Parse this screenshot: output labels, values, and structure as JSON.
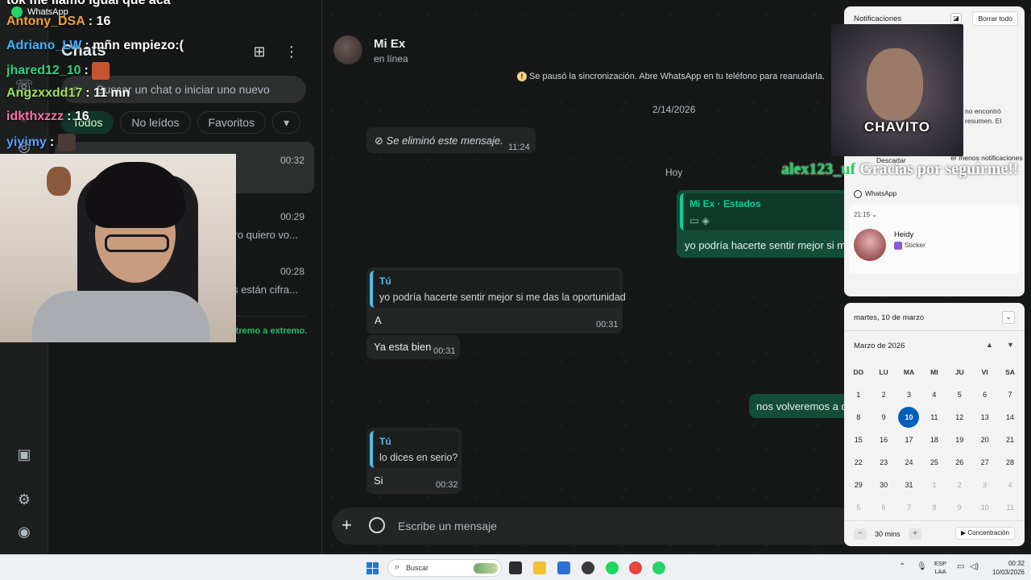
{
  "whatsapp": {
    "chat_list": {
      "title": "Chats",
      "search_placeholder": "Buscar un chat o iniciar uno nuevo",
      "filters": [
        "Todos",
        "No leídos",
        "Favoritos"
      ],
      "items": [
        {
          "time": "00:32",
          "preview": ""
        },
        {
          "time": "00:29",
          "preview": "ero quiero vo..."
        },
        {
          "time": "00:28",
          "preview": "s están cifra..."
        }
      ],
      "encryption_note": "os de extremo a extremo."
    },
    "conversation": {
      "contact_name": "Mi Ex",
      "contact_status": "en línea",
      "sync_notice": "Se pausó la sincronización. Abre WhatsApp en tu teléfono para reanudarla.",
      "date_1": "2/14/2026",
      "date_2": "Hoy",
      "messages": [
        {
          "text": "Se eliminó este mensaje.",
          "time": "11:24"
        },
        {
          "quote_name": "Mi Ex · Estados",
          "text": "yo podría hacerte sentir mejor si m"
        },
        {
          "quote_name": "Tú",
          "quote_text": "yo podría hacerte sentir mejor si me das la oportunidad",
          "text": "A",
          "time": "00:31"
        },
        {
          "text": "Ya esta bien",
          "time": "00:31"
        },
        {
          "text": "nos volveremos a d"
        },
        {
          "quote_name": "Tú",
          "quote_text": "lo dices en serio?",
          "text": "Si",
          "time": "00:32"
        }
      ],
      "composer_placeholder": "Escribe un mensaje"
    }
  },
  "stream_overlay": {
    "chat_lines": [
      {
        "user": "tok me llamo igual que aca",
        "color": "#ffffff",
        "text": ""
      },
      {
        "user": "Antony_DSA",
        "color": "#f0a238",
        "text": ": 16"
      },
      {
        "user": "Adriano_LW",
        "color": "#3fb4ff",
        "text": ": mñn empiezo:("
      },
      {
        "user": "jhared12_10",
        "color": "#35d07f",
        "text": ":"
      },
      {
        "user": "Angzxxdd17",
        "color": "#9be15d",
        "text": ": 11 mn"
      },
      {
        "user": "idkthxzzz",
        "color": "#ff6fa8",
        "text": ": 16"
      },
      {
        "user": "yiyimy",
        "color": "#5aa0ff",
        "text": ":"
      }
    ],
    "wa_tag": "WhatsApp",
    "alert_name": "CHAVITO",
    "alert_user": "alex123_uf",
    "alert_message": "Gracias por seguirme!!"
  },
  "notifications": {
    "title": "Notificaciones",
    "clear_all": "Borrar todo",
    "side_text_1": "no encontró",
    "side_text_2": "resumen.  El",
    "show_less": "er menos notificaciones",
    "discard": "Descartar",
    "app_name": "WhatsApp",
    "time": "21:15",
    "sender": "Heidy",
    "content": "Sticker"
  },
  "calendar": {
    "date_header": "martes, 10 de marzo",
    "month": "Marzo de 2026",
    "weekdays": [
      "DO",
      "LU",
      "MA",
      "MI",
      "JU",
      "VI",
      "SA"
    ],
    "days": [
      {
        "d": "1"
      },
      {
        "d": "2"
      },
      {
        "d": "3"
      },
      {
        "d": "4"
      },
      {
        "d": "5"
      },
      {
        "d": "6"
      },
      {
        "d": "7"
      },
      {
        "d": "8"
      },
      {
        "d": "9"
      },
      {
        "d": "10",
        "today": true
      },
      {
        "d": "11"
      },
      {
        "d": "12"
      },
      {
        "d": "13"
      },
      {
        "d": "14"
      },
      {
        "d": "15"
      },
      {
        "d": "16"
      },
      {
        "d": "17"
      },
      {
        "d": "18"
      },
      {
        "d": "19"
      },
      {
        "d": "20"
      },
      {
        "d": "21"
      },
      {
        "d": "22"
      },
      {
        "d": "23"
      },
      {
        "d": "24"
      },
      {
        "d": "25"
      },
      {
        "d": "26"
      },
      {
        "d": "27"
      },
      {
        "d": "28"
      },
      {
        "d": "29"
      },
      {
        "d": "30"
      },
      {
        "d": "31"
      },
      {
        "d": "1",
        "dim": true
      },
      {
        "d": "2",
        "dim": true
      },
      {
        "d": "3",
        "dim": true
      },
      {
        "d": "4",
        "dim": true
      },
      {
        "d": "5",
        "dim": true
      },
      {
        "d": "6",
        "dim": true
      },
      {
        "d": "7",
        "dim": true
      },
      {
        "d": "8",
        "dim": true
      },
      {
        "d": "9",
        "dim": true
      },
      {
        "d": "10",
        "dim": true
      },
      {
        "d": "11",
        "dim": true
      }
    ],
    "focus_minutes": "30 mins",
    "focus_button": "Concentración"
  },
  "taskbar": {
    "search_placeholder": "Buscar",
    "lang_1": "ESP",
    "lang_2": "LAA",
    "time": "00:32",
    "date": "10/03/2026"
  },
  "colors": {
    "accent_green": "#21c063",
    "outgoing_bubble": "#144d37",
    "today_circle": "#005fb8"
  }
}
